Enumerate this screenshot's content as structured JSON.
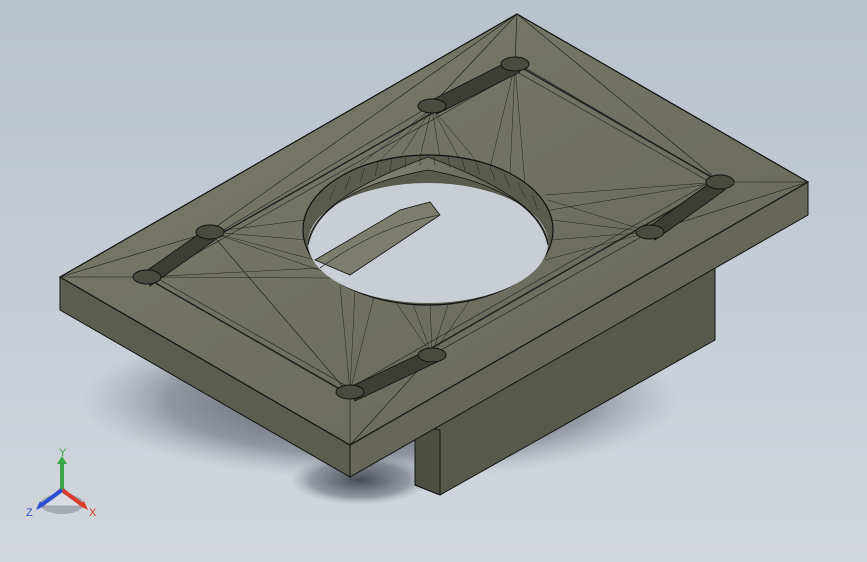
{
  "viewport": {
    "background_top": "#b9c1cb",
    "background_bottom": "#d2d7dd"
  },
  "model": {
    "face_color": "#6f705f",
    "edge_color": "#111111",
    "shadow_color": "#3a3f48"
  },
  "triad": {
    "x_label": "X",
    "y_label": "Y",
    "z_label": "Z",
    "x_color": "#d83a2b",
    "y_color": "#3aa84a",
    "z_color": "#2d4fd1"
  }
}
